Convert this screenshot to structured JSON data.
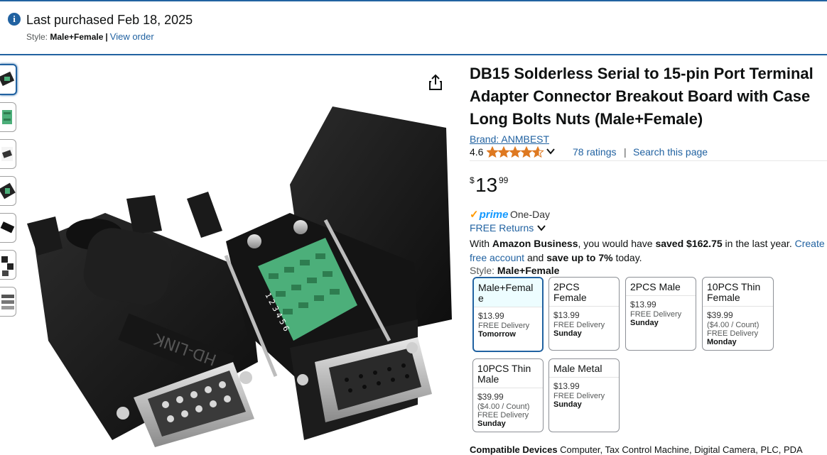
{
  "banner": {
    "last_purchased": "Last purchased Feb 18, 2025",
    "style_prefix": "Style: ",
    "style_value": "Male+Female",
    "separator": "|",
    "view_order": "View order"
  },
  "product": {
    "title_lines": [
      "DB15 Solderless Serial to 15-pin Port Terminal",
      "Adapter Connector Breakout Board with Case",
      "Long Bolts Nuts (Male+Female)"
    ],
    "brand": "Brand: ANMBEST",
    "rating_value": "4.6",
    "rating_stars": 4.6,
    "ratings_count": "78 ratings",
    "rating_sep": "|",
    "search_page": "Search this page",
    "price_symbol": "$",
    "price_whole": "13",
    "price_fraction": "99",
    "prime_text": "prime",
    "prime_delivery": "One-Day",
    "free_returns": "FREE Returns",
    "business_pre": "With ",
    "business_name": "Amazon Business",
    "business_mid": ", you would have ",
    "business_saved": "saved $162.75",
    "business_post": " in the last year. ",
    "business_link1": "Create a",
    "business_link2": "free account",
    "business_and": " and ",
    "business_save": "save up to 7%",
    "business_end": " today.",
    "style_label": "Style: ",
    "style_value": "Male+Female",
    "compat_label": "Compatible Devices",
    "compat_value": "Computer, Tax Control Machine, Digital Camera, PLC, PDA"
  },
  "variants": [
    {
      "name": "Male+Femal e",
      "price": "$13.99",
      "unit": "",
      "delivery": "FREE Delivery",
      "day": "Tomorrow",
      "selected": true
    },
    {
      "name": "2PCS Female",
      "price": "$13.99",
      "unit": "",
      "delivery": "FREE Delivery",
      "day": "Sunday",
      "selected": false
    },
    {
      "name": "2PCS Male",
      "price": "$13.99",
      "unit": "",
      "delivery": "FREE Delivery",
      "day": "Sunday",
      "selected": false
    },
    {
      "name": "10PCS Thin Female",
      "price": "$39.99",
      "unit": "($4.00 / Count)",
      "delivery": "FREE Delivery",
      "day": "Monday",
      "selected": false
    },
    {
      "name": "10PCS Thin Male",
      "price": "$39.99",
      "unit": "($4.00 / Count)",
      "delivery": "FREE Delivery",
      "day": "Sunday",
      "selected": false
    },
    {
      "name": "Male Metal",
      "price": "$13.99",
      "unit": "",
      "delivery": "FREE Delivery",
      "day": "Sunday",
      "selected": false
    }
  ],
  "icons": {
    "info": "info-icon",
    "share": "share-icon",
    "chevron": "chevron-down-icon",
    "star": "star-icon"
  },
  "colors": {
    "link": "#2162a1",
    "star": "#de7921",
    "prime": "#1399ff",
    "prime_check": "#ff9900",
    "terminal_green": "#4caf7a"
  }
}
